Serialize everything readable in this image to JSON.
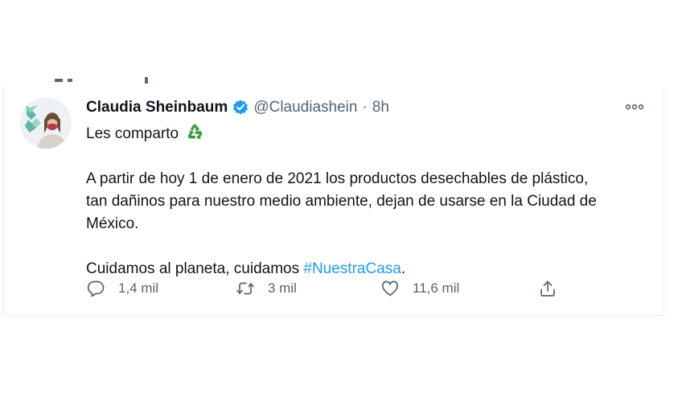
{
  "tweet": {
    "author_name": "Claudia Sheinbaum",
    "handle": "@Claudiashein",
    "separator": "·",
    "time": "8h",
    "text_line1": "Les comparto",
    "text_line2": "A partir de hoy 1 de enero de 2021 los productos desechables de plástico,",
    "text_line3": "tan dañinos para nuestro medio ambiente, dejan de usarse en la Ciudad de",
    "text_line4": "México.",
    "text_line5_prefix": "Cuidamos al planeta, cuidamos ",
    "hashtag": "#NuestraCasa",
    "text_line5_suffix": ".",
    "emoji": "recycle-icon"
  },
  "actions": {
    "replies": "1,4 mil",
    "retweets": "3 mil",
    "likes": "11,6 mil"
  },
  "icons": {
    "verified": "verified-badge-icon",
    "more": "more-icon",
    "reply": "reply-icon",
    "retweet": "retweet-icon",
    "like": "heart-icon",
    "share": "share-icon"
  },
  "colors": {
    "verified_blue": "#1d9bf0",
    "hashtag_blue": "#1d9bf0",
    "secondary_text": "#536471",
    "recycle_green": "#3a9a3c"
  }
}
